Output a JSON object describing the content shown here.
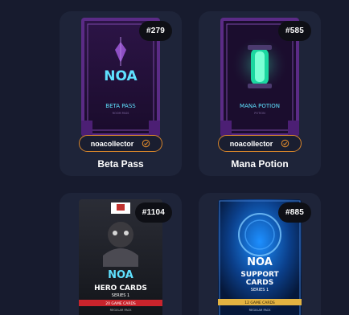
{
  "cards": [
    {
      "number": "#279",
      "art": {
        "brand": "NOA",
        "caption": "BETA PASS",
        "subcaption": "ROOM PASS",
        "icon": "beta-pass-art"
      },
      "owner": "noacollector",
      "title": "Beta Pass"
    },
    {
      "number": "#585",
      "art": {
        "brand": "NOA",
        "caption": "MANA POTION",
        "subcaption": "POTION",
        "icon": "mana-potion-art"
      },
      "owner": "noacollector",
      "title": "Mana Potion"
    },
    {
      "number": "#1104",
      "art": {
        "brand": "NOA",
        "line1": "HERO CARDS",
        "line2": "SERIES 1",
        "strip": "20 GAME CARDS",
        "strip_sub": "REGULAR PACK",
        "icon": "hero-cards-art"
      },
      "owner": "",
      "title": ""
    },
    {
      "number": "#885",
      "art": {
        "brand": "NOA",
        "line1": "SUPPORT",
        "line2": "CARDS",
        "line3": "SERIES 1",
        "strip": "12 GAME CARDS",
        "strip_sub": "REGULAR PACK",
        "icon": "support-cards-art"
      },
      "owner": "",
      "title": ""
    }
  ],
  "colors": {
    "background": "#171b2e",
    "card": "#1e2439",
    "owner_border": "#d7852b",
    "badge_bg": "#0e0f15"
  }
}
